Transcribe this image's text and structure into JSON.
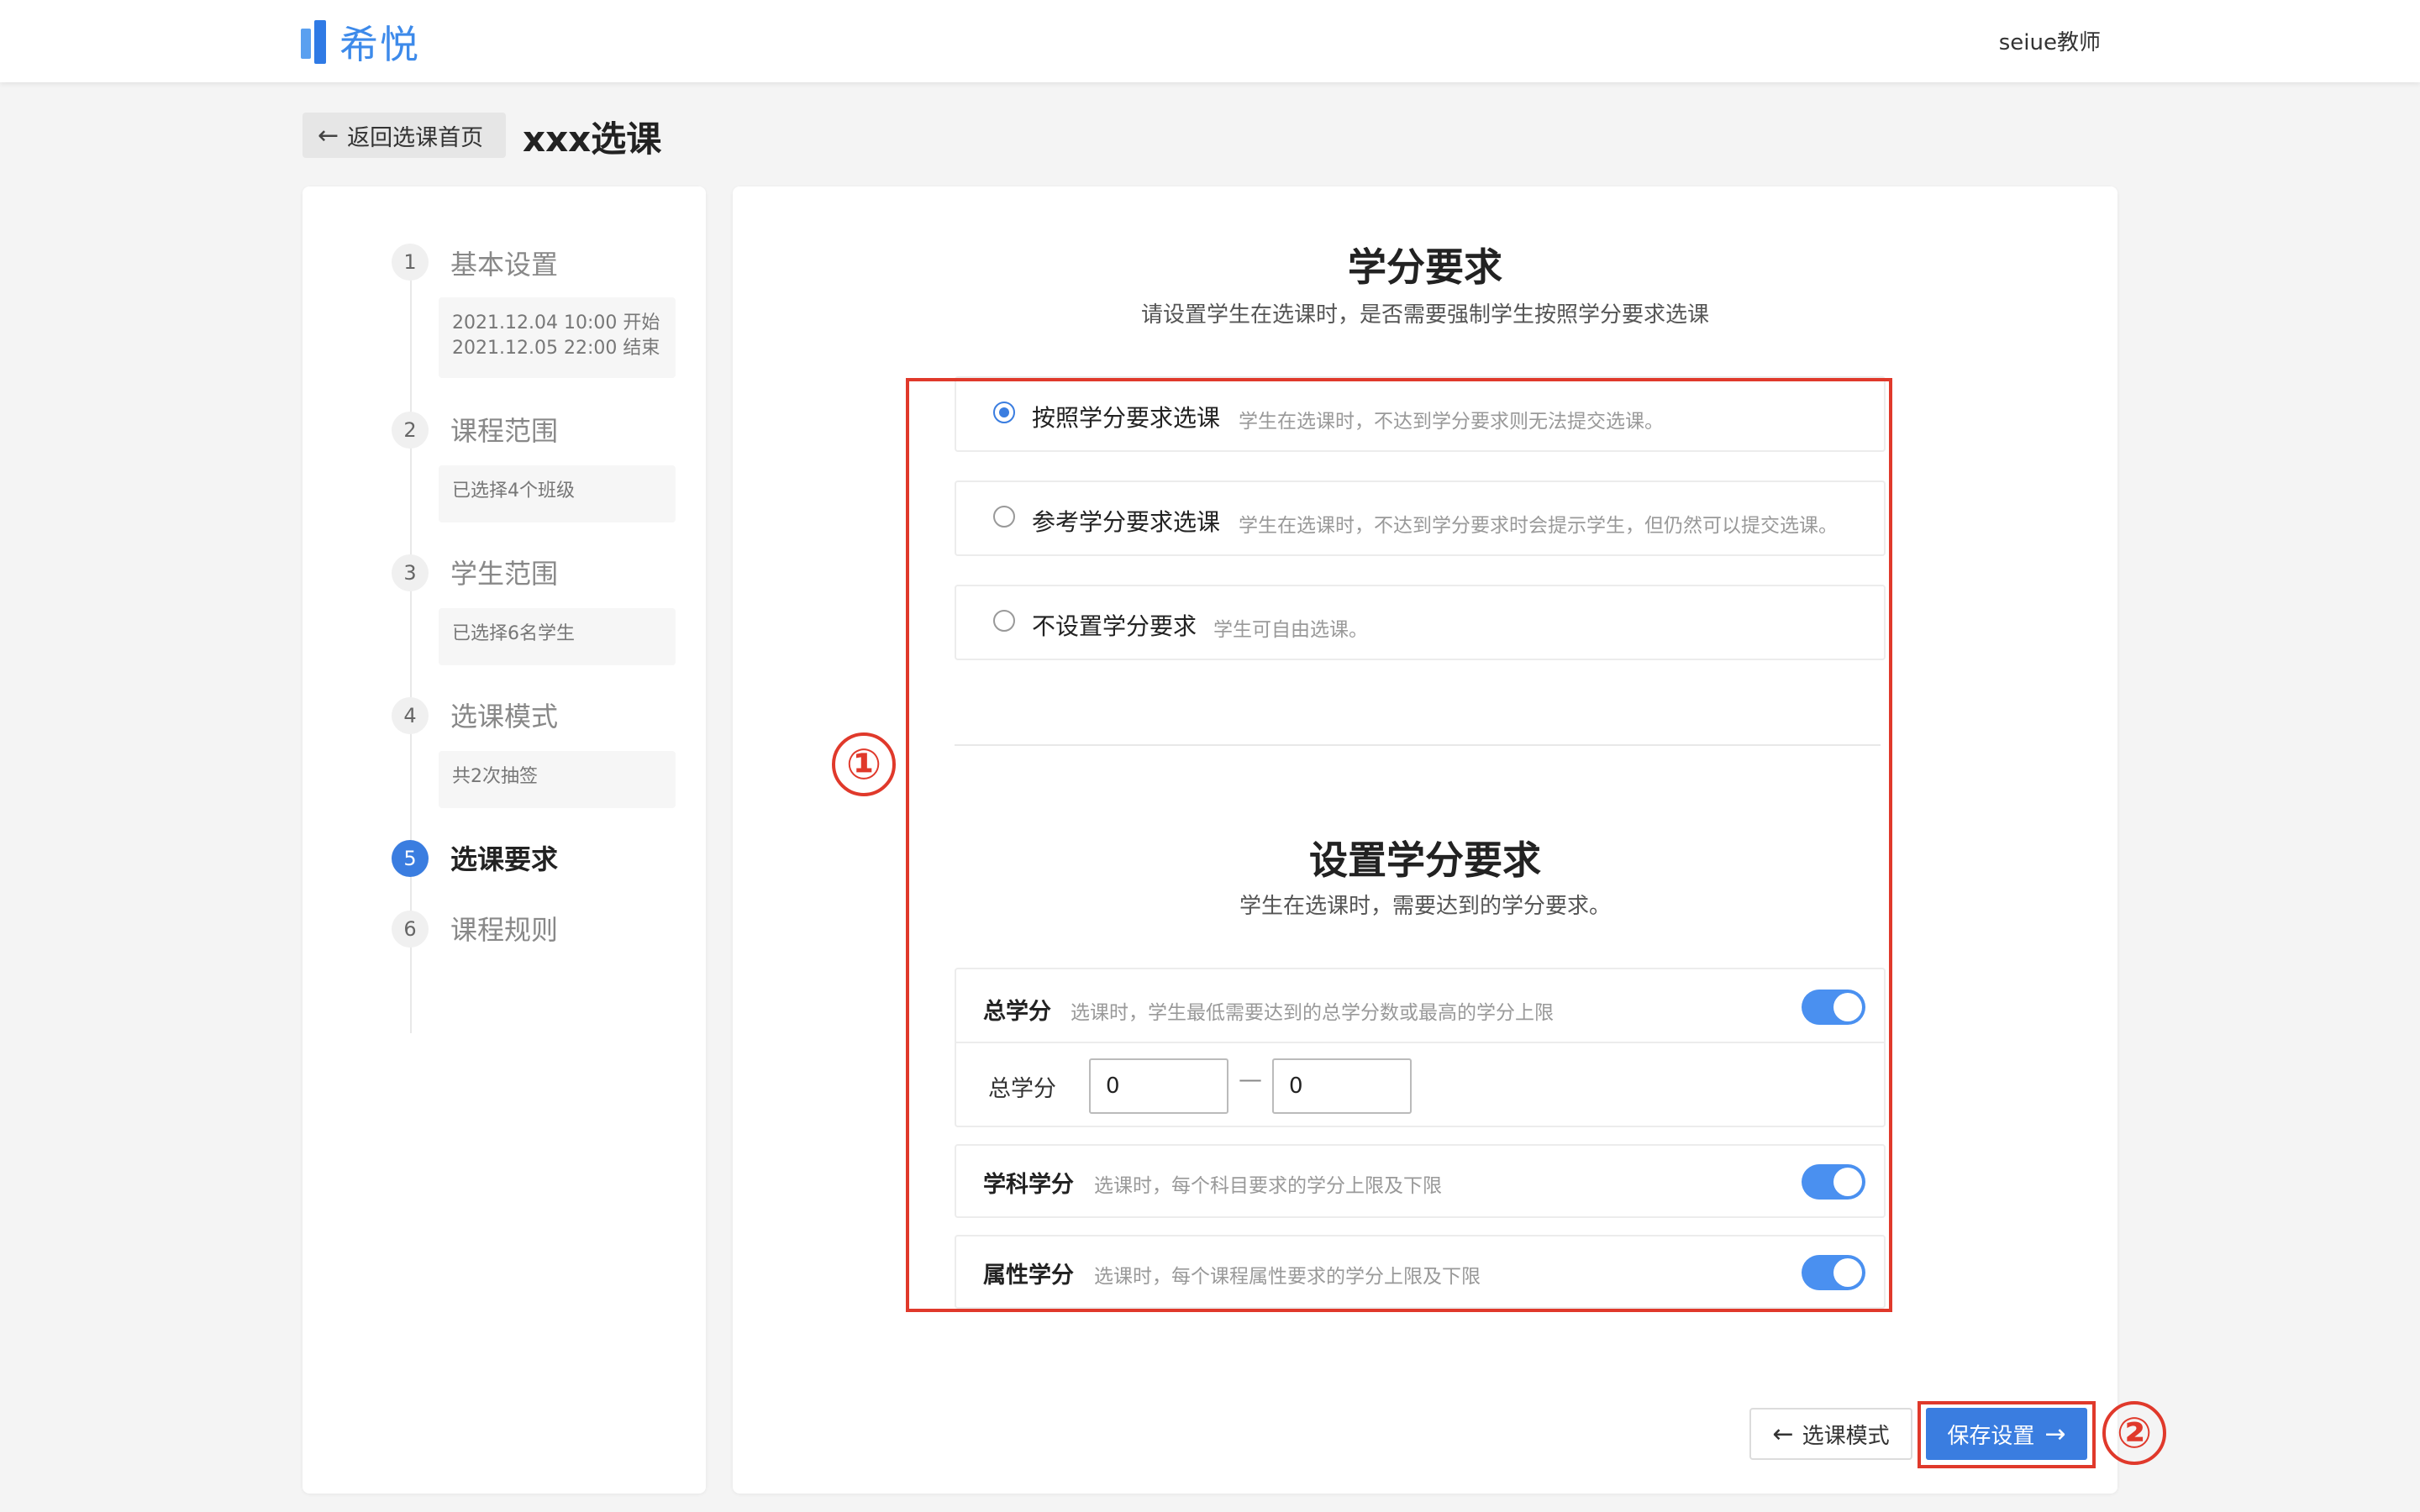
{
  "brand": {
    "name": "希悦"
  },
  "header": {
    "user": "seiue教师"
  },
  "nav": {
    "back_label": "返回选课首页",
    "page_title": "xxx选课"
  },
  "steps": [
    {
      "num": "1",
      "label": "基本设置",
      "summary_lines": [
        "2021.12.04 10:00 开始",
        "2021.12.05 22:00 结束"
      ]
    },
    {
      "num": "2",
      "label": "课程范围",
      "summary": "已选择4个班级"
    },
    {
      "num": "3",
      "label": "学生范围",
      "summary": "已选择6名学生"
    },
    {
      "num": "4",
      "label": "选课模式",
      "summary": "共2次抽签"
    },
    {
      "num": "5",
      "label": "选课要求",
      "active": true
    },
    {
      "num": "6",
      "label": "课程规则"
    }
  ],
  "section1": {
    "title": "学分要求",
    "subtitle": "请设置学生在选课时，是否需要强制学生按照学分要求选课",
    "options": [
      {
        "label": "按照学分要求选课",
        "desc": "学生在选课时，不达到学分要求则无法提交选课。",
        "checked": true
      },
      {
        "label": "参考学分要求选课",
        "desc": "学生在选课时，不达到学分要求时会提示学生，但仍然可以提交选课。",
        "checked": false
      },
      {
        "label": "不设置学分要求",
        "desc": "学生可自由选课。",
        "checked": false
      }
    ]
  },
  "section2": {
    "title": "设置学分要求",
    "subtitle": "学生在选课时，需要达到的学分要求。",
    "total": {
      "label": "总学分",
      "desc": "选课时，学生最低需要达到的总学分数或最高的学分上限",
      "enabled": true,
      "field_label": "总学分",
      "min": "0",
      "max": "0",
      "separator": "—"
    },
    "subject": {
      "label": "学科学分",
      "desc": "选课时，每个科目要求的学分上限及下限",
      "enabled": true
    },
    "attribute": {
      "label": "属性学分",
      "desc": "选课时，每个课程属性要求的学分上限及下限",
      "enabled": true
    }
  },
  "footer": {
    "prev_label": "选课模式",
    "save_label": "保存设置"
  },
  "annotations": {
    "mark1": "①",
    "mark2": "②"
  },
  "colors": {
    "accent": "#3a7de0",
    "annotation": "#e0392b",
    "toggle": "#4a90f0"
  }
}
